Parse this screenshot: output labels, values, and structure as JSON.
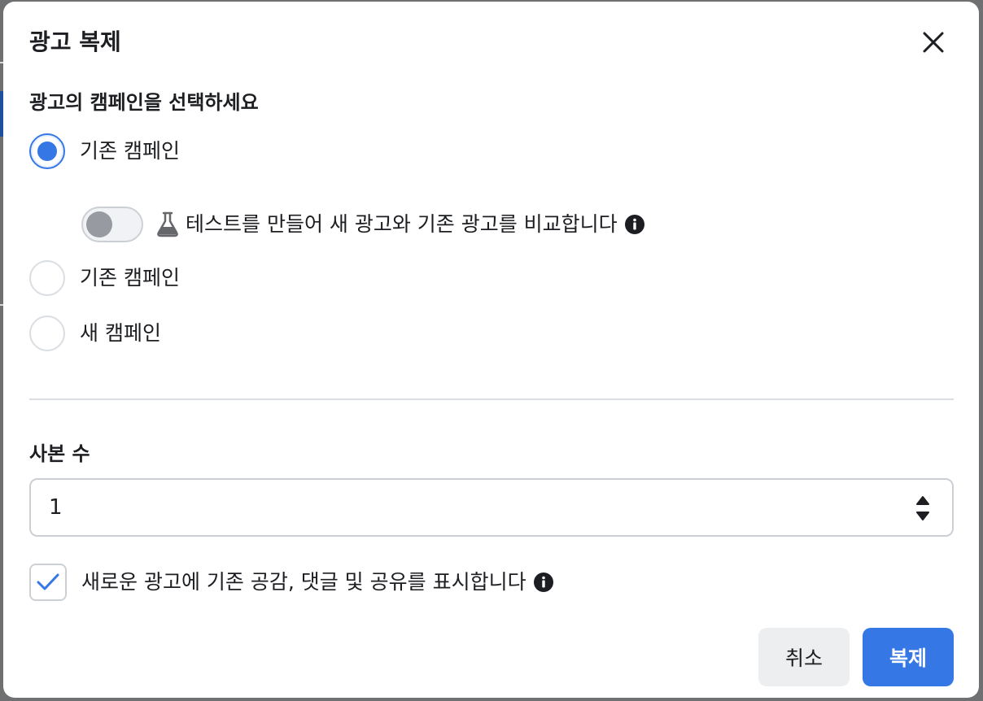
{
  "dialog": {
    "title": "광고 복제",
    "campaign_section": {
      "label": "광고의 캠페인을 선택하세요",
      "options": [
        {
          "label": "기존 캠페인",
          "selected": true
        },
        {
          "label": "기존 캠페인",
          "selected": false
        },
        {
          "label": "새 캠페인",
          "selected": false
        }
      ],
      "test_toggle": {
        "label": "테스트를 만들어 새 광고와 기존 광고를 비교합니다",
        "enabled": false,
        "icon": "flask-icon"
      }
    },
    "copies": {
      "label": "사본 수",
      "value": "1"
    },
    "show_engagement": {
      "label": "새로운 광고에 기존 공감, 댓글 및 공유를 표시합니다",
      "checked": true
    },
    "buttons": {
      "cancel": "취소",
      "duplicate": "복제"
    }
  },
  "colors": {
    "accent": "#3578e5",
    "backdrop": "#6f7072",
    "border": "#ccd0d5",
    "cancel_bg": "#edeef0"
  },
  "icons": [
    "close-icon",
    "flask-icon",
    "info-icon",
    "chevron-up-icon",
    "chevron-down-icon",
    "checkmark-icon"
  ]
}
